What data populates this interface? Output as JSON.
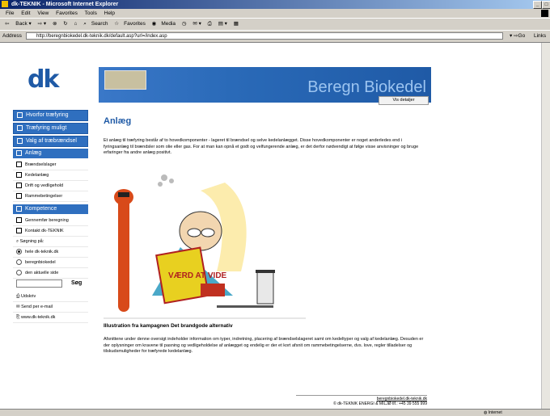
{
  "window": {
    "title": "dk-TEKNIK - Microsoft Internet Explorer"
  },
  "menu": [
    "File",
    "Edit",
    "View",
    "Favorites",
    "Tools",
    "Help"
  ],
  "toolbar": {
    "back": "Back",
    "search": "Search",
    "favorites": "Favorites",
    "media": "Media"
  },
  "address": {
    "label": "Address",
    "url": "http://beregnbiokedel.dk-teknik.dk/default.asp?url=/index.asp",
    "go": "Go",
    "links": "Links"
  },
  "site": {
    "logo": "dk",
    "banner_title": "Beregn Biokedel",
    "details_button": "Vis detaljer"
  },
  "nav": {
    "sections": [
      {
        "label": "Hvorfor træfyring"
      },
      {
        "label": "Træfyring muligt"
      },
      {
        "label": "Valg af træbrændsel"
      }
    ],
    "anlaeg": {
      "label": "Anlæg",
      "items": [
        "Brændselslager",
        "Kedelanlæg",
        "Drift og vedligehold",
        "Rammebetingelser"
      ]
    },
    "kompetence": {
      "label": "Kompetence"
    },
    "actions": [
      "Gennemfør beregning",
      "Kontakt dk-TEKNIK"
    ],
    "search": {
      "label": "Søgning på:",
      "options": [
        "hele dk-teknik.dk",
        "beregnbiokedel",
        "den aktuelle side"
      ],
      "button": "Søg"
    },
    "tools": [
      "Udskriv",
      "Send per e-mail",
      "www.dk-teknik.dk"
    ]
  },
  "main": {
    "heading": "Anlæg",
    "intro": "Et anlæg til træfyring består af to hovedkomponenter - lageret til brændsel og selve kedelanlægget. Disse hovedkomponenter er noget anderledes end i fyringsanlæg til brændsler som olie eller gas. For at man kan opnå et godt og velfungerende anlæg, er det derfor nødvendigt at følge visse anvisninger og bruge erfaringer fra andre anlæg positivt.",
    "book_text": "VÆRD AT VIDE",
    "caption": "Illustration fra kampagnen Det brandgode alternativ",
    "body": "Afsnittene under denne oversigt indeholder information om typer, indretning, placering af brændselslageret samt om kedeltyper og valg af kedelanlæg. Desuden er der oplysninger om kravene til pasning og vedligeholdelse af anlægget og endelig er der et kort afsnit om rammebetingelserne, dvs. love, regler tilladelser og tilskudsmuligheder for træfyrede kedelanlæg.",
    "footer_link": "beregnbiokedel.dk-teknik.dk",
    "footer_address": "© dk-TEKNIK ENERGI & MILJØ tlf.: +45 39 555 999"
  },
  "status": {
    "zone": "Internet"
  }
}
